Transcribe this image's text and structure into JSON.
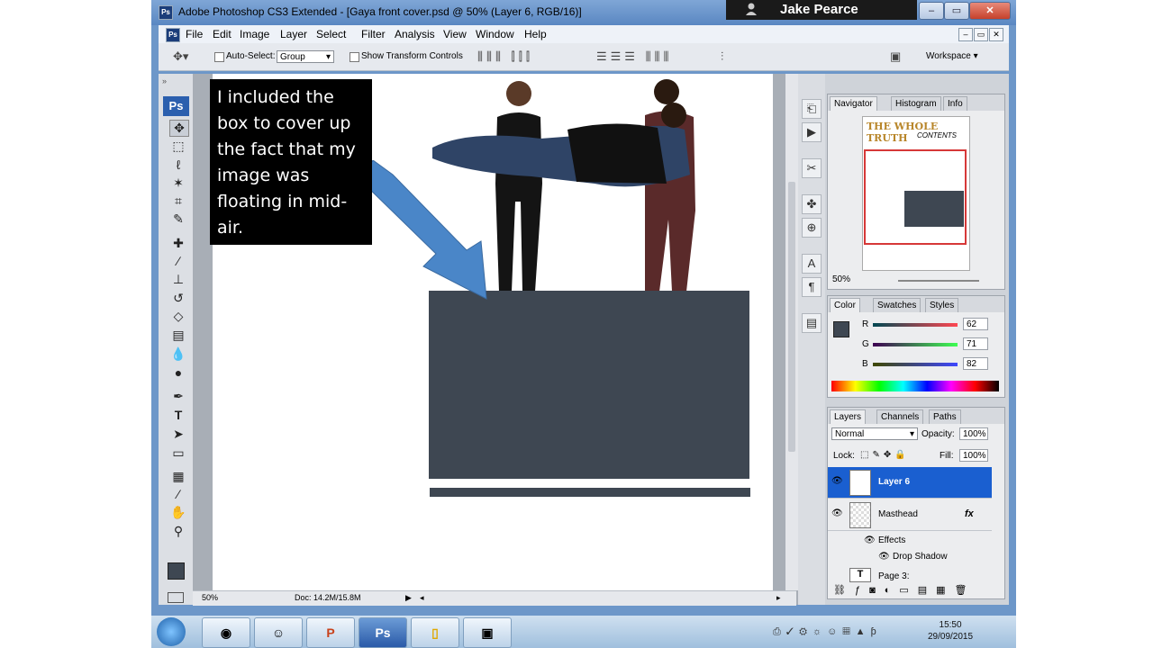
{
  "window": {
    "title": "Adobe Photoshop CS3 Extended - [Gaya front cover.psd @ 50% (Layer 6, RGB/16)]",
    "app_badge": "Ps",
    "user_name": "Jake Pearce",
    "minimize": "–",
    "maximize": "▭",
    "close": "✕"
  },
  "menubar": {
    "items": [
      "File",
      "Edit",
      "Image",
      "Layer",
      "Select",
      "Filter",
      "Analysis",
      "View",
      "Window",
      "Help"
    ]
  },
  "options": {
    "auto_select_label": "Auto-Select:",
    "auto_select_value": "Group",
    "transform_label": "Show Transform Controls",
    "workspace_label": "Workspace ▾"
  },
  "toolbox": {
    "logo": "Ps"
  },
  "annotation": {
    "text": "I included the box to cover up the fact that my image was floating in mid-air."
  },
  "status": {
    "zoom": "50%",
    "doc": "Doc: 14.2M/15.8M"
  },
  "navigator": {
    "tabs": [
      "Navigator",
      "Histogram",
      "Info"
    ],
    "zoom": "50%",
    "thumb_title": "THE WHOLE TRUTH",
    "thumb_subtitle": "CONTENTS"
  },
  "color_panel": {
    "tabs": [
      "Color",
      "Swatches",
      "Styles"
    ],
    "r_label": "R",
    "g_label": "G",
    "b_label": "B",
    "r": "62",
    "g": "71",
    "b": "82",
    "foreground": "#3e4752"
  },
  "layers_panel": {
    "tabs": [
      "Layers",
      "Channels",
      "Paths"
    ],
    "blend_mode": "Normal",
    "opacity_label": "Opacity:",
    "opacity": "100%",
    "lock_label": "Lock:",
    "fill_label": "Fill:",
    "fill": "100%",
    "layers": [
      {
        "name": "Layer 6"
      },
      {
        "name": "Masthead"
      }
    ],
    "effects_label": "Effects",
    "drop_shadow_label": "Drop Shadow",
    "next_layer": "Page 3:"
  },
  "taskbar": {
    "time": "15:50",
    "date": "29/09/2015"
  },
  "colors": {
    "box": "#3e4752",
    "arrow": "#4a86c8",
    "selected_layer": "#1a5fd0"
  }
}
